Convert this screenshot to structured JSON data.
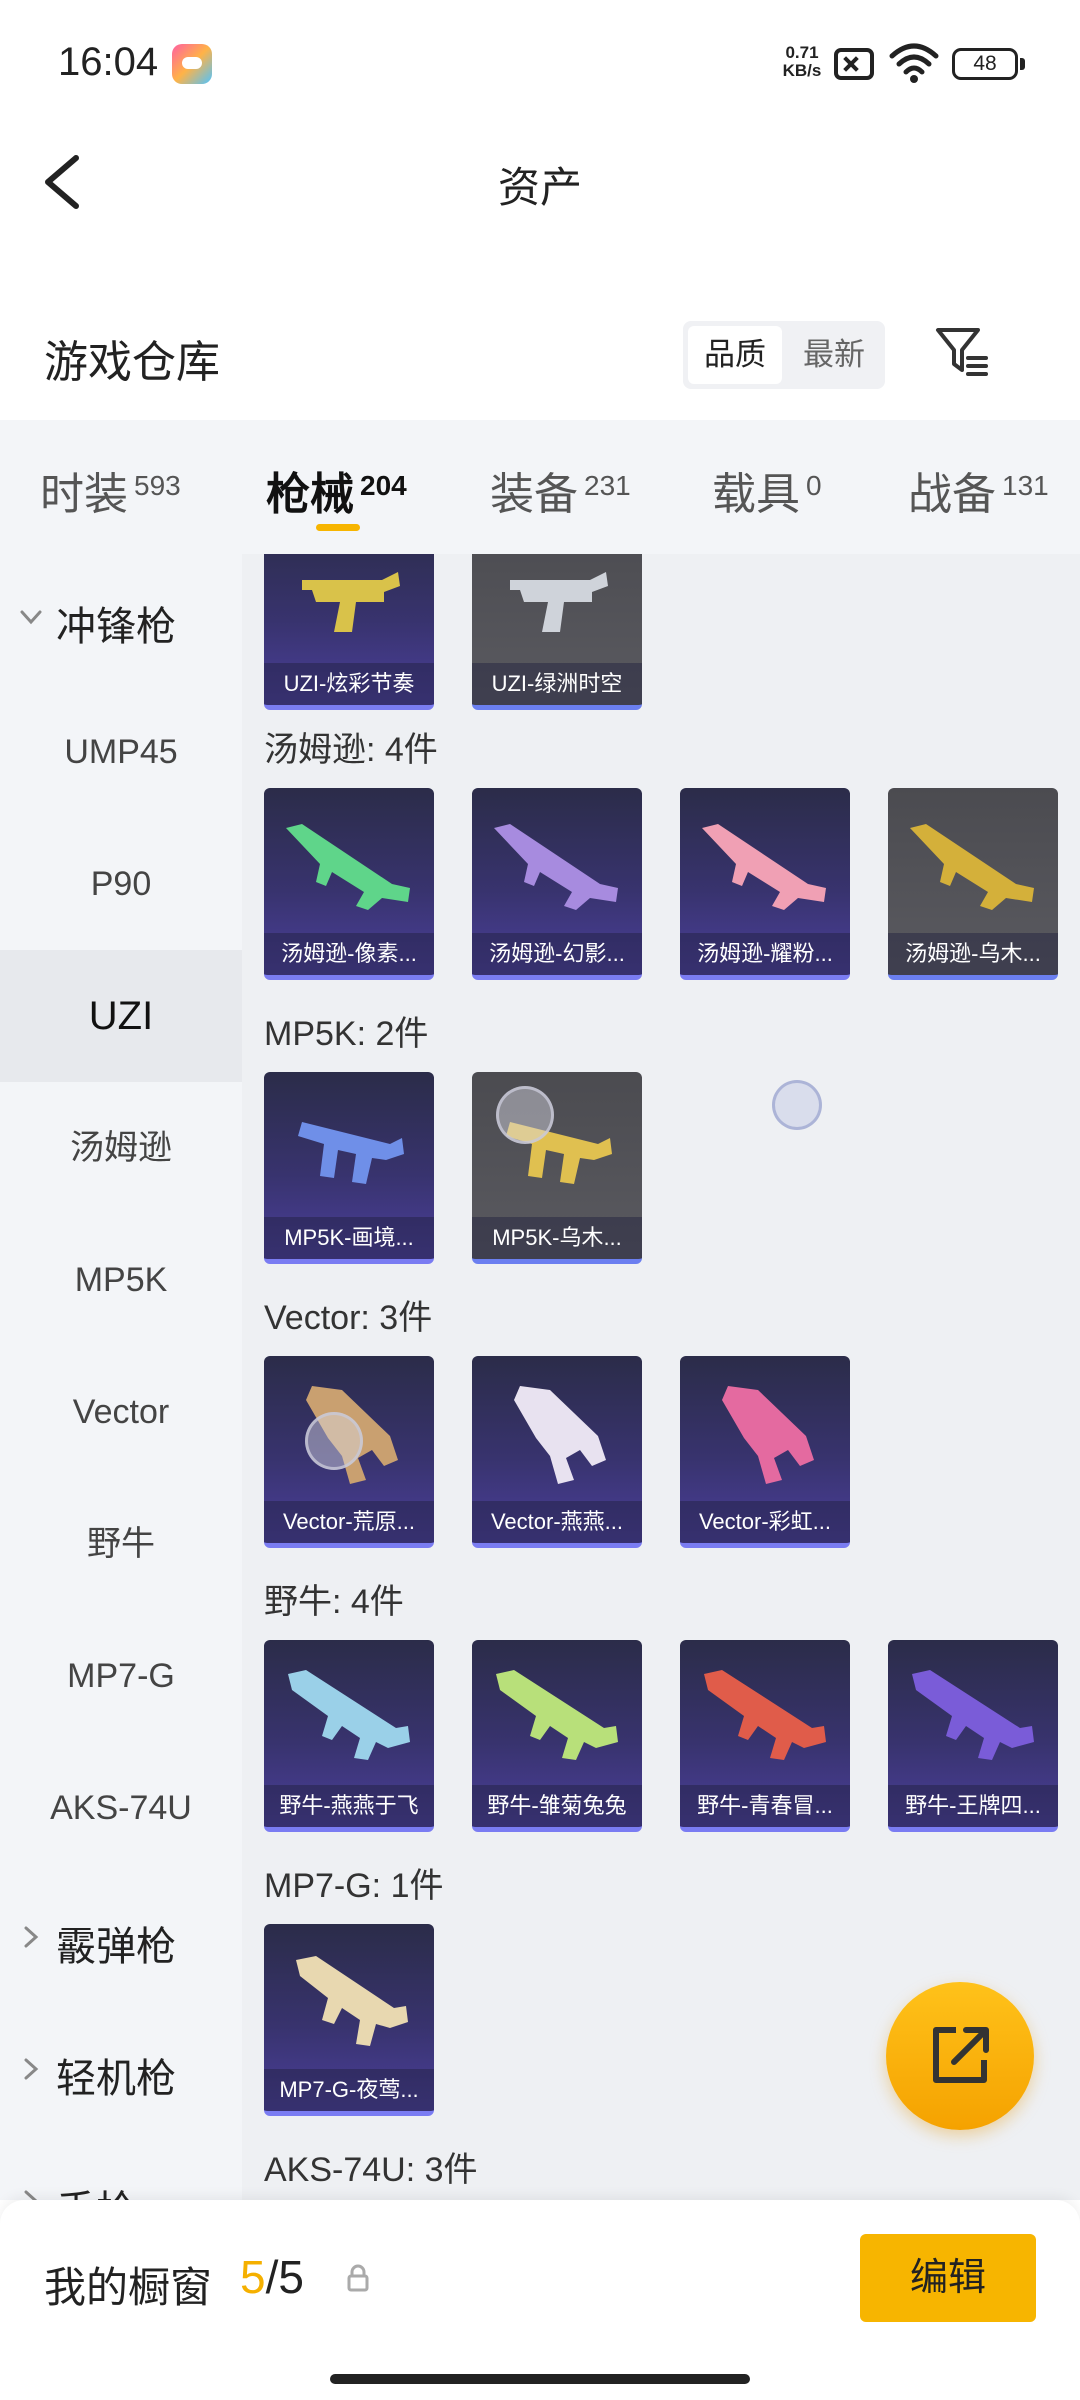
{
  "status_bar": {
    "time": "16:04",
    "net_speed_value": "0.71",
    "net_speed_unit": "KB/s",
    "battery": "48",
    "icons": [
      "game-app-icon",
      "sim-disabled-icon",
      "wifi-icon",
      "battery-icon"
    ]
  },
  "header": {
    "title": "资产",
    "back_icon": "chevron-left-icon"
  },
  "warehouse": {
    "title": "游戏仓库",
    "sort_options": [
      "品质",
      "最新"
    ],
    "selected_sort": "品质",
    "filter_icon": "filter-icon"
  },
  "category_tabs": [
    {
      "name": "时装",
      "count": "593"
    },
    {
      "name": "枪械",
      "count": "204",
      "active": true
    },
    {
      "name": "装备",
      "count": "231"
    },
    {
      "name": "载具",
      "count": "0"
    },
    {
      "name": "战备",
      "count": "131"
    }
  ],
  "sidebar": {
    "expanded_group": "冲锋枪",
    "items": [
      "UMP45",
      "P90",
      "UZI",
      "汤姆逊",
      "MP5K",
      "Vector",
      "野牛",
      "MP7-G",
      "AKS-74U"
    ],
    "selected": "UZI",
    "collapsed_groups": [
      "霰弹枪",
      "轻机枪",
      "手枪"
    ]
  },
  "content": {
    "top_cards": [
      "UZI-炫彩节奏",
      "UZI-绿洲时空"
    ],
    "sections": [
      {
        "label": "汤姆逊: 4件",
        "items": [
          "汤姆逊-像素...",
          "汤姆逊-幻影...",
          "汤姆逊-耀粉...",
          "汤姆逊-乌木..."
        ]
      },
      {
        "label": "MP5K: 2件",
        "items": [
          "MP5K-画境...",
          "MP5K-乌木..."
        ]
      },
      {
        "label": "Vector: 3件",
        "items": [
          "Vector-荒原...",
          "Vector-燕燕...",
          "Vector-彩虹..."
        ]
      },
      {
        "label": "野牛: 4件",
        "items": [
          "野牛-燕燕于飞",
          "野牛-雏菊兔兔",
          "野牛-青春冒...",
          "野牛-王牌四..."
        ]
      },
      {
        "label": "MP7-G: 1件",
        "items": [
          "MP7-G-夜莺..."
        ]
      },
      {
        "label": "AKS-74U: 3件",
        "items": []
      }
    ],
    "weapon_colors": [
      "#d9c24a",
      "#cfd3da",
      "#5fd58a",
      "#a78bdf",
      "#f0a0b4",
      "#d4b03a",
      "#6f8fe8",
      "#e0c050",
      "#c9a070",
      "#e8e2f0",
      "#e46aa0",
      "#9ad0e8",
      "#b8e07a",
      "#e05c4a",
      "#7a5cd8",
      "#e8d8b0"
    ]
  },
  "fab": {
    "icon": "share-icon"
  },
  "bottom_bar": {
    "label": "我的橱窗",
    "current": "5",
    "total": "/5",
    "lock_icon": "lock-icon",
    "edit_label": "编辑"
  }
}
